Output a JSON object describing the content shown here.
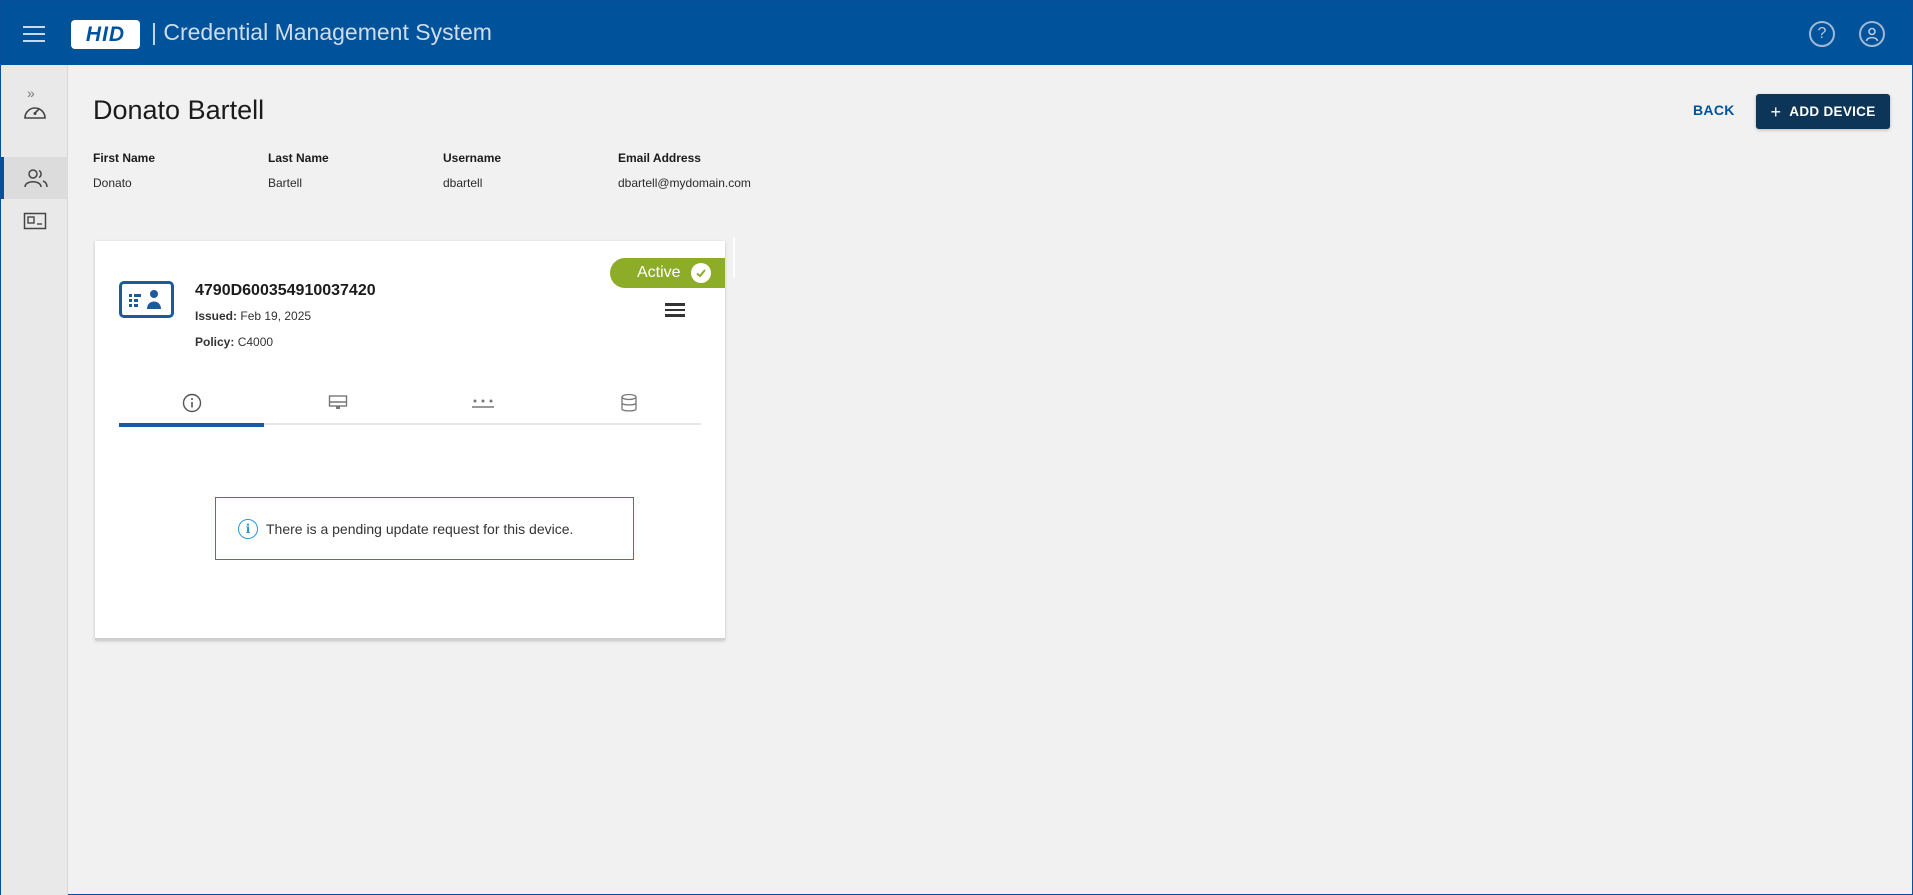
{
  "header": {
    "logo_text": "HID",
    "app_title": "| Credential Management System"
  },
  "page": {
    "title": "Donato Bartell",
    "back_label": "BACK",
    "add_device_label": "ADD DEVICE"
  },
  "user": {
    "fields": [
      {
        "label": "First Name",
        "value": "Donato"
      },
      {
        "label": "Last Name",
        "value": "Bartell"
      },
      {
        "label": "Username",
        "value": "dbartell"
      },
      {
        "label": "Email Address",
        "value": "dbartell@mydomain.com"
      }
    ]
  },
  "device": {
    "id": "4790D600354910037420",
    "issued_label": "Issued:",
    "issued_value": "Feb 19, 2025",
    "policy_label": "Policy:",
    "policy_value": "C4000",
    "status": "Active",
    "status_color": "#8dad29",
    "tabs": [
      {
        "icon": "info-icon"
      },
      {
        "icon": "desktop-icon"
      },
      {
        "icon": "password-dots-icon"
      },
      {
        "icon": "database-icon"
      }
    ],
    "notice": "There is a pending update request for this device."
  },
  "sidebar": {
    "items": [
      {
        "icon": "expand-icon"
      },
      {
        "icon": "dashboard-icon"
      },
      {
        "icon": "users-icon"
      },
      {
        "icon": "card-icon"
      }
    ]
  },
  "colors": {
    "brand": "#00539b",
    "button_dark": "#0d3557",
    "notice_border": "#e13a3a"
  }
}
